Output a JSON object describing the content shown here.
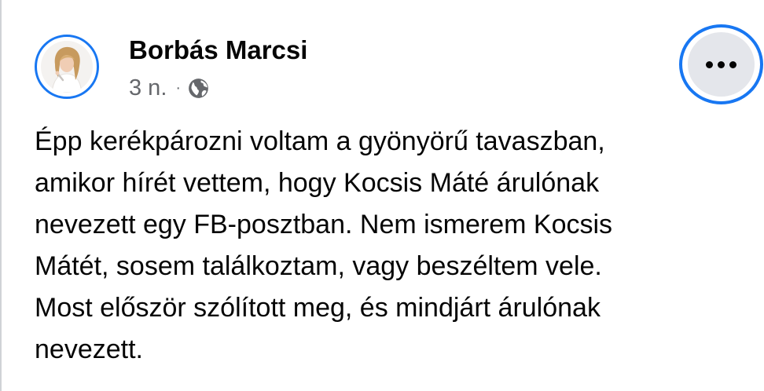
{
  "post": {
    "author": "Borbás Marcsi",
    "timestamp": "3 n.",
    "separator": "·",
    "audience_icon": "globe-icon",
    "more_icon": "more-options-icon",
    "text": "Épp kerékpározni voltam a gyönyörű tavaszban,\namikor hírét vettem, hogy Kocsis Máté árulónak\nnevezett egy FB-posztban. Nem ismerem Kocsis\nMátét, sosem találkoztam, vagy beszéltem vele.\nMost először szólított meg, és mindjárt árulónak\nnevezett."
  },
  "colors": {
    "highlight_ring": "#1877f2",
    "text_primary": "#050505",
    "text_secondary": "#65676b",
    "button_bg": "#e4e6eb"
  }
}
